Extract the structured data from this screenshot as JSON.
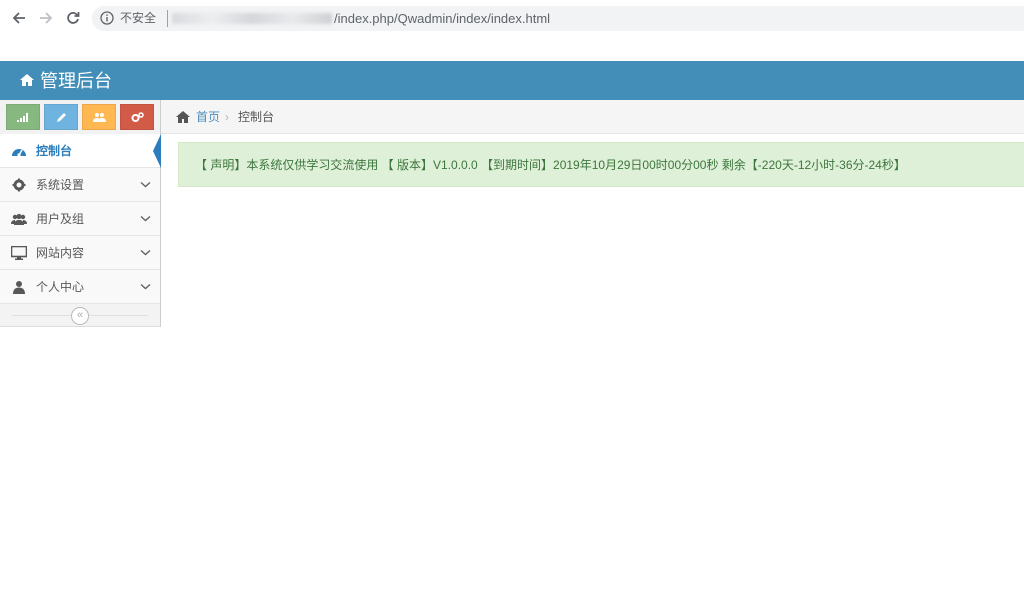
{
  "browser": {
    "insecure_label": "不安全",
    "url_path": "/index.php/Qwadmin/index/index.html"
  },
  "colors": {
    "header": "#438eb9",
    "active": "#2b7dbc",
    "shortcut_green": "#87b87f",
    "shortcut_blue": "#6fb3e0",
    "shortcut_orange": "#ffb752",
    "shortcut_red": "#d15b47",
    "alert_bg": "#dff0d8",
    "alert_text": "#3c763d"
  },
  "header": {
    "icon": "home-icon",
    "title": "管理后台"
  },
  "sidebar": {
    "shortcuts": [
      {
        "icon": "signal-icon"
      },
      {
        "icon": "pencil-icon"
      },
      {
        "icon": "users-icon"
      },
      {
        "icon": "cogs-icon"
      }
    ],
    "items": [
      {
        "label": "控制台",
        "icon": "dashboard-icon",
        "active": true
      },
      {
        "label": "系统设置",
        "icon": "gear-icon"
      },
      {
        "label": "用户及组",
        "icon": "users-icon"
      },
      {
        "label": "网站内容",
        "icon": "desktop-icon"
      },
      {
        "label": "个人中心",
        "icon": "user-icon"
      }
    ],
    "collapse_glyph": "«"
  },
  "breadcrumb": {
    "home": "首页",
    "separator": "›",
    "current": "控制台"
  },
  "notice": {
    "text": "【 声明】本系统仅供学习交流使用 【 版本】V1.0.0.0 【到期时间】2019年10月29日00时00分00秒 剩余【-220天-12小时-36分-24秒】"
  }
}
